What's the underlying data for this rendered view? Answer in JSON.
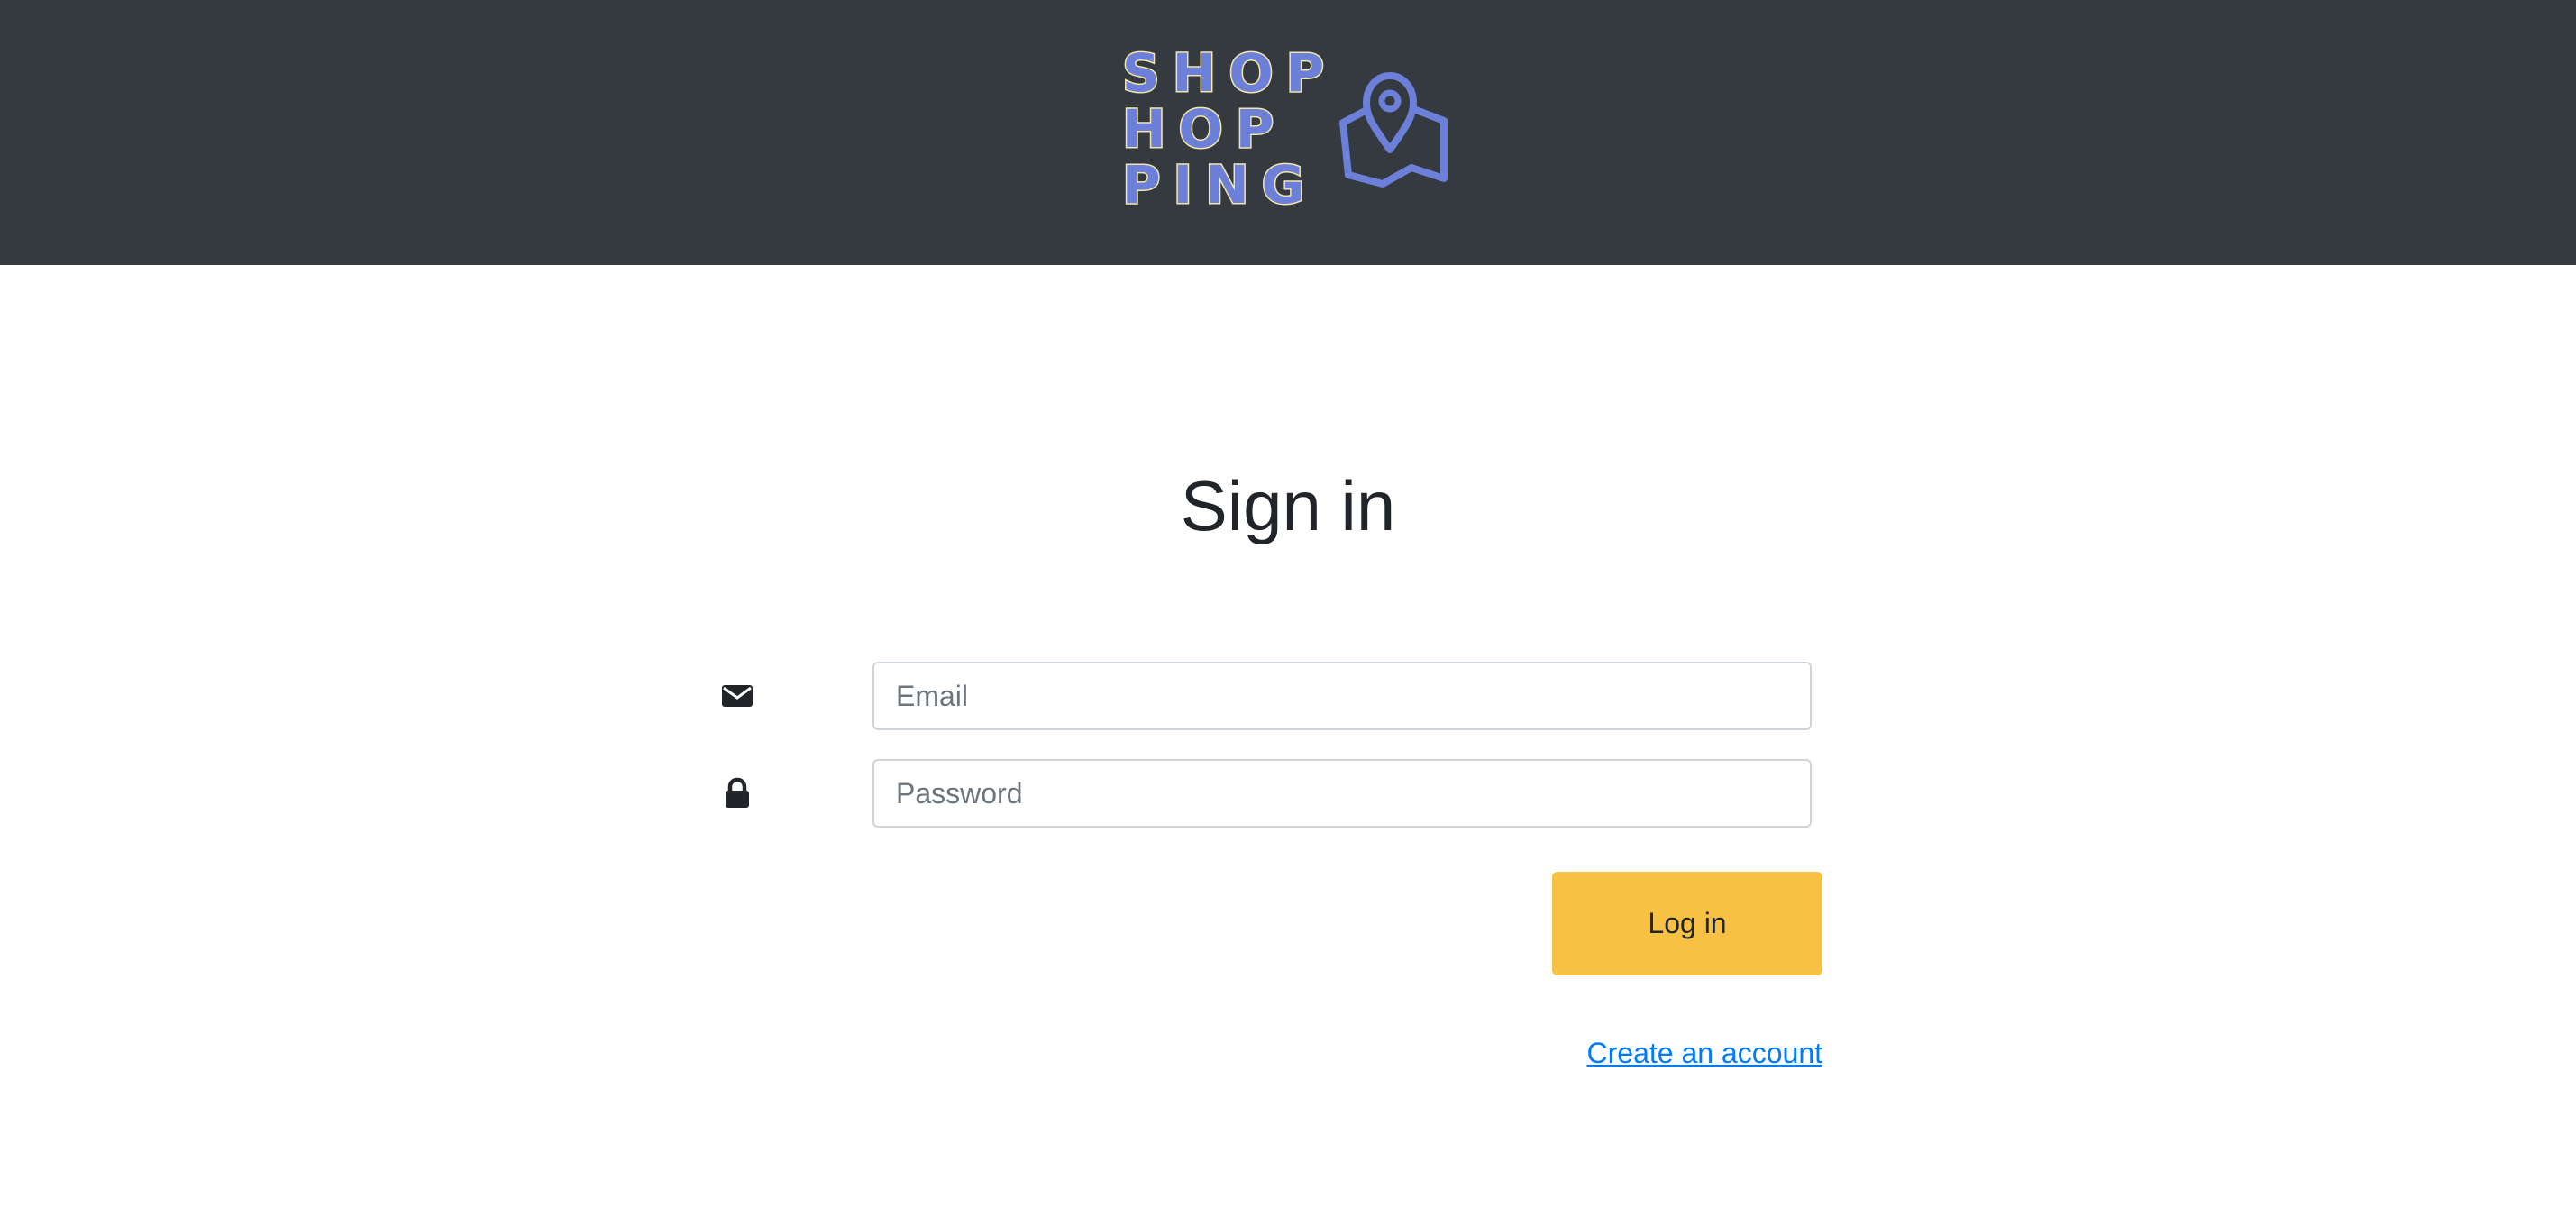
{
  "header": {
    "logo": {
      "lines": [
        "SHOP",
        "HOP",
        "PING"
      ],
      "icon": "map-pin-icon",
      "colors": {
        "fill": "#6c7fd9",
        "outline": "#f3e6a8"
      }
    },
    "background": "#343a40"
  },
  "main": {
    "title": "Sign in",
    "email": {
      "icon": "envelope-icon",
      "placeholder": "Email",
      "value": ""
    },
    "password": {
      "icon": "lock-icon",
      "placeholder": "Password",
      "value": ""
    },
    "login_button": {
      "label": "Log in",
      "color": "#f7c244"
    },
    "create_account_link": {
      "label": "Create an account",
      "color": "#007bff"
    }
  }
}
